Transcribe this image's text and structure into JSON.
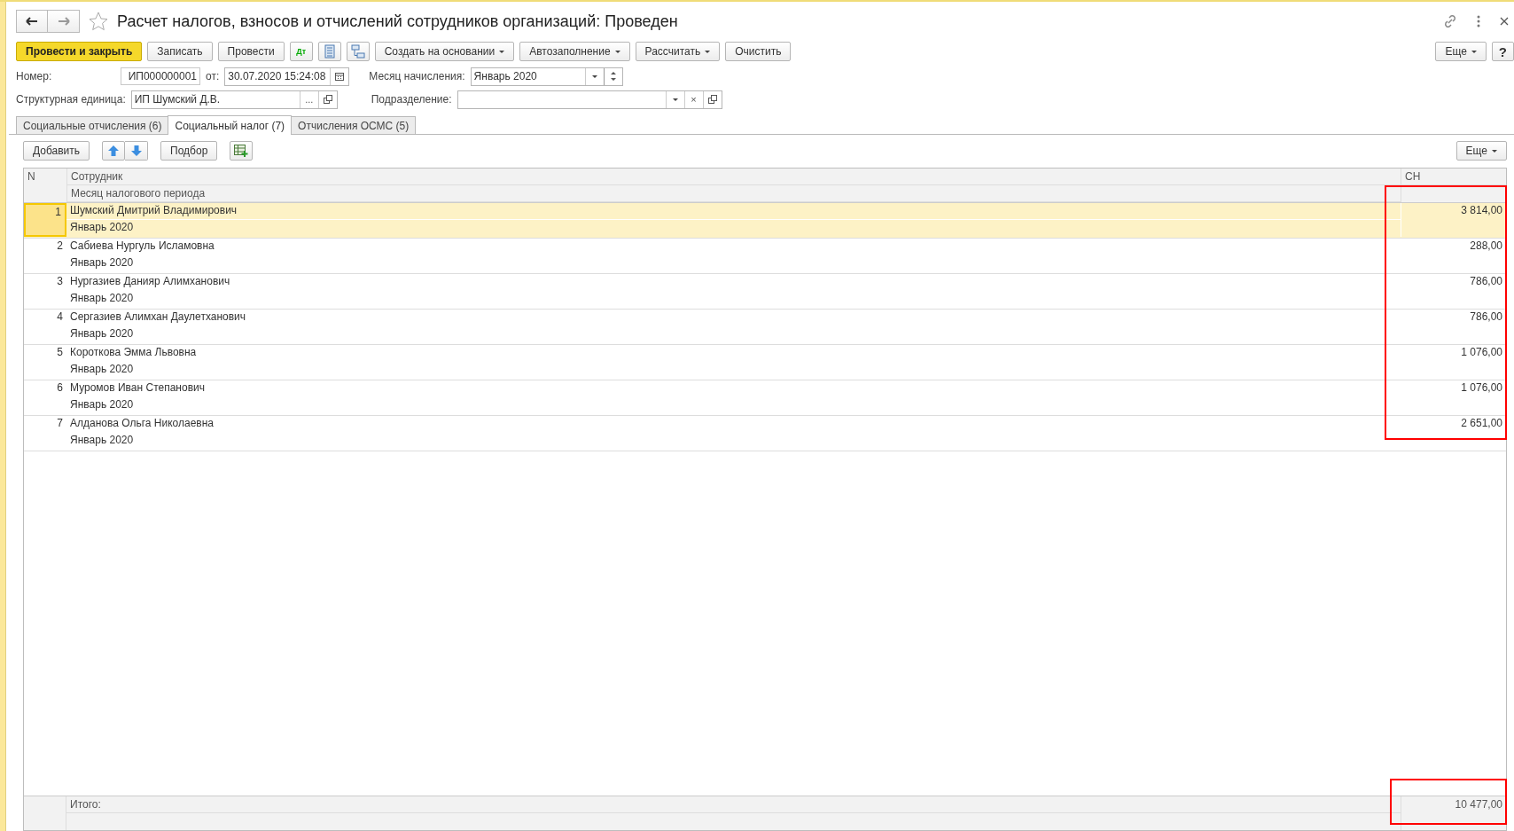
{
  "window": {
    "title": "Расчет налогов, взносов и отчислений сотрудников организаций: Проведен"
  },
  "toolbar": [
    {
      "kind": "primary",
      "label": "Провести и закрыть"
    },
    {
      "kind": "button",
      "label": "Записать"
    },
    {
      "kind": "button",
      "label": "Провести"
    },
    {
      "kind": "dtkt",
      "label": "Дт"
    },
    {
      "kind": "list"
    },
    {
      "kind": "structure"
    },
    {
      "kind": "dropdown",
      "label": "Создать на основании"
    },
    {
      "kind": "dropdown",
      "label": "Автозаполнение"
    },
    {
      "kind": "dropdown",
      "label": "Рассчитать"
    },
    {
      "kind": "button",
      "label": "Очистить"
    }
  ],
  "toolbar_extra": {
    "more": "Еще",
    "help": "?"
  },
  "fields": {
    "number_label": "Номер:",
    "number": "ИП000000001",
    "date_label": "от:",
    "date": "30.07.2020 15:24:08",
    "month_label": "Месяц начисления:",
    "month": "Январь 2020",
    "unit_label": "Структурная единица:",
    "unit": "ИП Шумский Д.В.",
    "unit_select": "...",
    "division_label": "Подразделение:",
    "division_clear": "×"
  },
  "tabs": [
    {
      "label": "Социальные отчисления (6)",
      "selected": false
    },
    {
      "label": "Социальный налог (7)",
      "selected": true
    },
    {
      "label": "Отчисления ОСМС (5)",
      "selected": false
    }
  ],
  "table_toolbar": {
    "add": "Добавить",
    "pick": "Подбор",
    "more": "Еще"
  },
  "table": {
    "columns": [
      "N",
      "Сотрудник",
      "Месяц налогового периода",
      "СН"
    ],
    "rows": [
      {
        "n": "1",
        "employee": "Шумский Дмитрий Владимирович",
        "month": "Январь 2020",
        "sn": "3 814,00",
        "selected": true
      },
      {
        "n": "2",
        "employee": "Сабиева Нургуль Исламовна",
        "month": "Январь 2020",
        "sn": "288,00",
        "selected": false
      },
      {
        "n": "3",
        "employee": "Нургазиев Данияр Алимханович",
        "month": "Январь 2020",
        "sn": "786,00",
        "selected": false
      },
      {
        "n": "4",
        "employee": "Сергазиев Алимхан Даулетханович",
        "month": "Январь 2020",
        "sn": "786,00",
        "selected": false
      },
      {
        "n": "5",
        "employee": "Короткова Эмма Львовна",
        "month": "Январь 2020",
        "sn": "1 076,00",
        "selected": false
      },
      {
        "n": "6",
        "employee": "Муромов Иван Степанович",
        "month": "Январь 2020",
        "sn": "1 076,00",
        "selected": false
      },
      {
        "n": "7",
        "employee": "Алданова Ольга Николаевна",
        "month": "Январь 2020",
        "sn": "2 651,00",
        "selected": false
      }
    ],
    "footer": {
      "label": "Итого:",
      "total": "10 477,00"
    }
  }
}
